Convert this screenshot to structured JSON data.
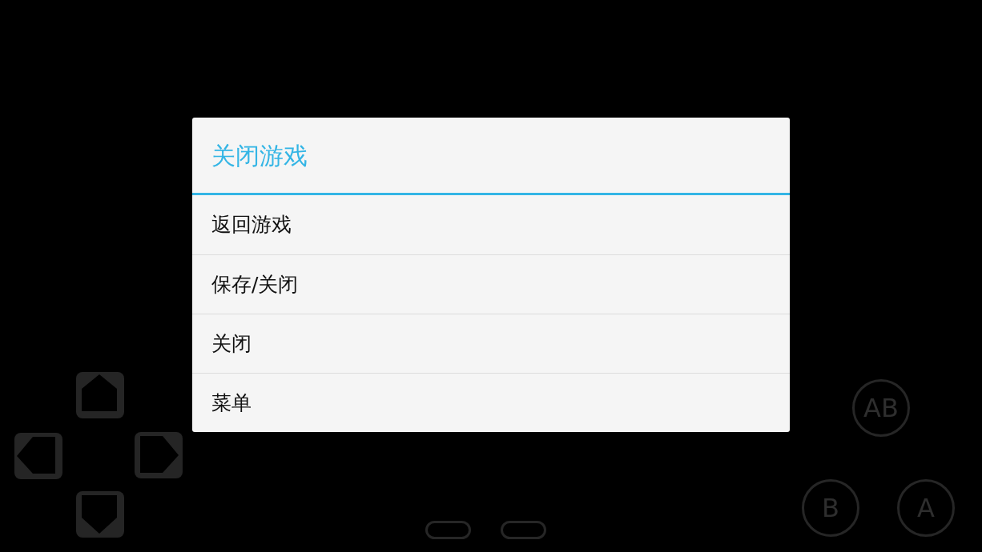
{
  "dialog": {
    "title": "关闭游戏",
    "items": [
      {
        "label": "返回游戏"
      },
      {
        "label": "保存/关闭"
      },
      {
        "label": "关闭"
      },
      {
        "label": "菜单"
      }
    ]
  },
  "controls": {
    "dpad": [
      {
        "kind": "up"
      },
      {
        "kind": "left"
      },
      {
        "kind": "right"
      },
      {
        "kind": "down"
      }
    ],
    "buttons": [
      {
        "label": "AB"
      },
      {
        "label": "B"
      },
      {
        "label": "A"
      }
    ]
  }
}
